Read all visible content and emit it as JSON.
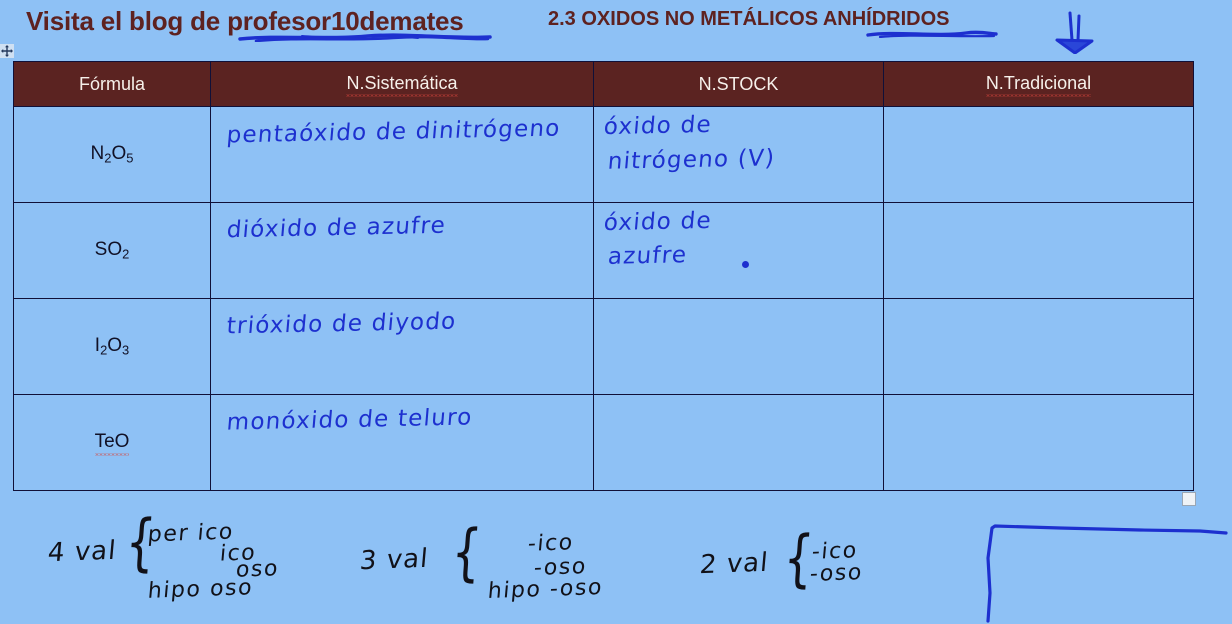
{
  "header": {
    "blog_title": "Visita el blog de profesor10demates",
    "section_title": "2.3 OXIDOS NO METÁLICOS ANHÍDRIDOS",
    "blog_title_color": "#5e2220",
    "ink_color": "#1d30cf",
    "arrow_mark": "blue-arrow-annotation"
  },
  "table": {
    "header_bg": "#5b2321",
    "header_text_color": "#f6f0ea",
    "cell_bg": "#8ec1f5",
    "border_color": "#101038",
    "columns": [
      {
        "label": "Fórmula",
        "misspelled": false
      },
      {
        "label": "N.Sistemática",
        "misspelled": true
      },
      {
        "label": "N.STOCK",
        "misspelled": false
      },
      {
        "label": "N.Tradicional",
        "misspelled": true
      }
    ],
    "rows": [
      {
        "formula": {
          "text": "N2O5",
          "main": "N",
          "sub1": "2",
          "mid": "O",
          "sub2": "5",
          "misspelled": false
        },
        "sistematica": "pentaóxido de dinitrógeno",
        "stock_line1": "óxido de",
        "stock_line2": "nitrógeno (V)",
        "stock_dot": false,
        "tradicional": ""
      },
      {
        "formula": {
          "text": "SO2",
          "main": "S",
          "sub1": "",
          "mid": "O",
          "sub2": "2",
          "misspelled": false
        },
        "sistematica": "dióxido de azufre",
        "stock_line1": "óxido de",
        "stock_line2": "azufre",
        "stock_dot": true,
        "tradicional": ""
      },
      {
        "formula": {
          "text": "I2O3",
          "main": "I",
          "sub1": "2",
          "mid": "O",
          "sub2": "3",
          "misspelled": false
        },
        "sistematica": "trióxido de diyodo",
        "stock_line1": "",
        "stock_line2": "",
        "stock_dot": false,
        "tradicional": ""
      },
      {
        "formula": {
          "text": "TeO",
          "main": "Te",
          "sub1": "",
          "mid": "O",
          "sub2": "",
          "misspelled": true
        },
        "sistematica": "monóxido de teluro",
        "stock_line1": "",
        "stock_line2": "",
        "stock_dot": false,
        "tradicional": ""
      }
    ]
  },
  "notes": [
    {
      "label": "4 val",
      "brace": "{",
      "suffix_lines": [
        "per  ico",
        "ico",
        "oso",
        "hipo    oso"
      ]
    },
    {
      "label": "3 val",
      "brace": "{",
      "suffix_lines": [
        "-ico",
        "-oso",
        "hipo -oso"
      ]
    },
    {
      "label": "2 val",
      "brace": "{",
      "suffix_lines": [
        "-ico",
        "-oso"
      ]
    }
  ],
  "annotations": {
    "corner_pen_mark": "blue-L-shaped-pen-stroke",
    "move_handle": "table-move-handle",
    "resize_handle": "table-resize-handle"
  }
}
